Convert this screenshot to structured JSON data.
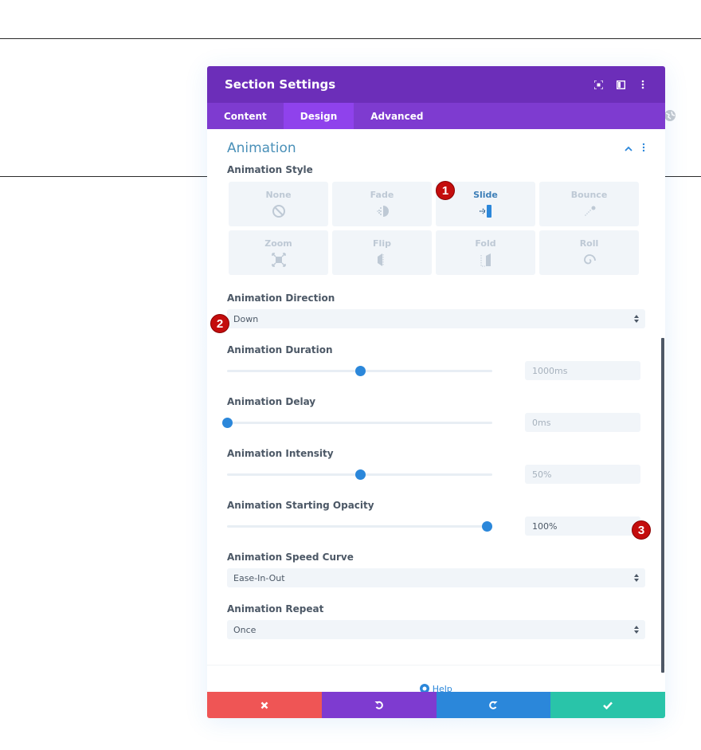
{
  "modal": {
    "title": "Section Settings",
    "header_icons": [
      "focus-icon",
      "split-view-icon",
      "more-vertical-icon"
    ],
    "tabs": [
      {
        "label": "Content",
        "active": false
      },
      {
        "label": "Design",
        "active": true
      },
      {
        "label": "Advanced",
        "active": false
      }
    ]
  },
  "section": {
    "title": "Animation",
    "collapse_icon": "chevron-up-icon",
    "options_icon": "more-vertical-icon"
  },
  "animation_style": {
    "label": "Animation Style",
    "options": [
      {
        "label": "None",
        "icon": "no-symbol-icon",
        "selected": false
      },
      {
        "label": "Fade",
        "icon": "fade-icon",
        "selected": false
      },
      {
        "label": "Slide",
        "icon": "slide-icon",
        "selected": true
      },
      {
        "label": "Bounce",
        "icon": "bounce-icon",
        "selected": false
      },
      {
        "label": "Zoom",
        "icon": "zoom-icon",
        "selected": false
      },
      {
        "label": "Flip",
        "icon": "flip-icon",
        "selected": false
      },
      {
        "label": "Fold",
        "icon": "fold-icon",
        "selected": false
      },
      {
        "label": "Roll",
        "icon": "roll-icon",
        "selected": false
      }
    ]
  },
  "animation_direction": {
    "label": "Animation Direction",
    "value": "Down"
  },
  "animation_duration": {
    "label": "Animation Duration",
    "value": "1000ms",
    "slider_fraction": 0.5
  },
  "animation_delay": {
    "label": "Animation Delay",
    "value": "0ms",
    "slider_fraction": 0.0
  },
  "animation_intensity": {
    "label": "Animation Intensity",
    "value": "50%",
    "slider_fraction": 0.5
  },
  "animation_opacity": {
    "label": "Animation Starting Opacity",
    "value": "100%",
    "slider_fraction": 0.98
  },
  "animation_speed_curve": {
    "label": "Animation Speed Curve",
    "value": "Ease-In-Out"
  },
  "animation_repeat": {
    "label": "Animation Repeat",
    "value": "Once"
  },
  "help": {
    "label": "Help"
  },
  "footer": {
    "cancel_icon": "close-icon",
    "undo_icon": "undo-icon",
    "redo_icon": "redo-icon",
    "save_icon": "check-icon"
  },
  "badges": [
    "1",
    "2",
    "3"
  ],
  "colors": {
    "header": "#6c2eb9",
    "tabs": "#7e3bd0",
    "active_tab": "#8f42ec",
    "accent": "#2b87da",
    "cancel": "#ef5555",
    "save": "#29c4a9",
    "badge": "#c40d0d"
  }
}
